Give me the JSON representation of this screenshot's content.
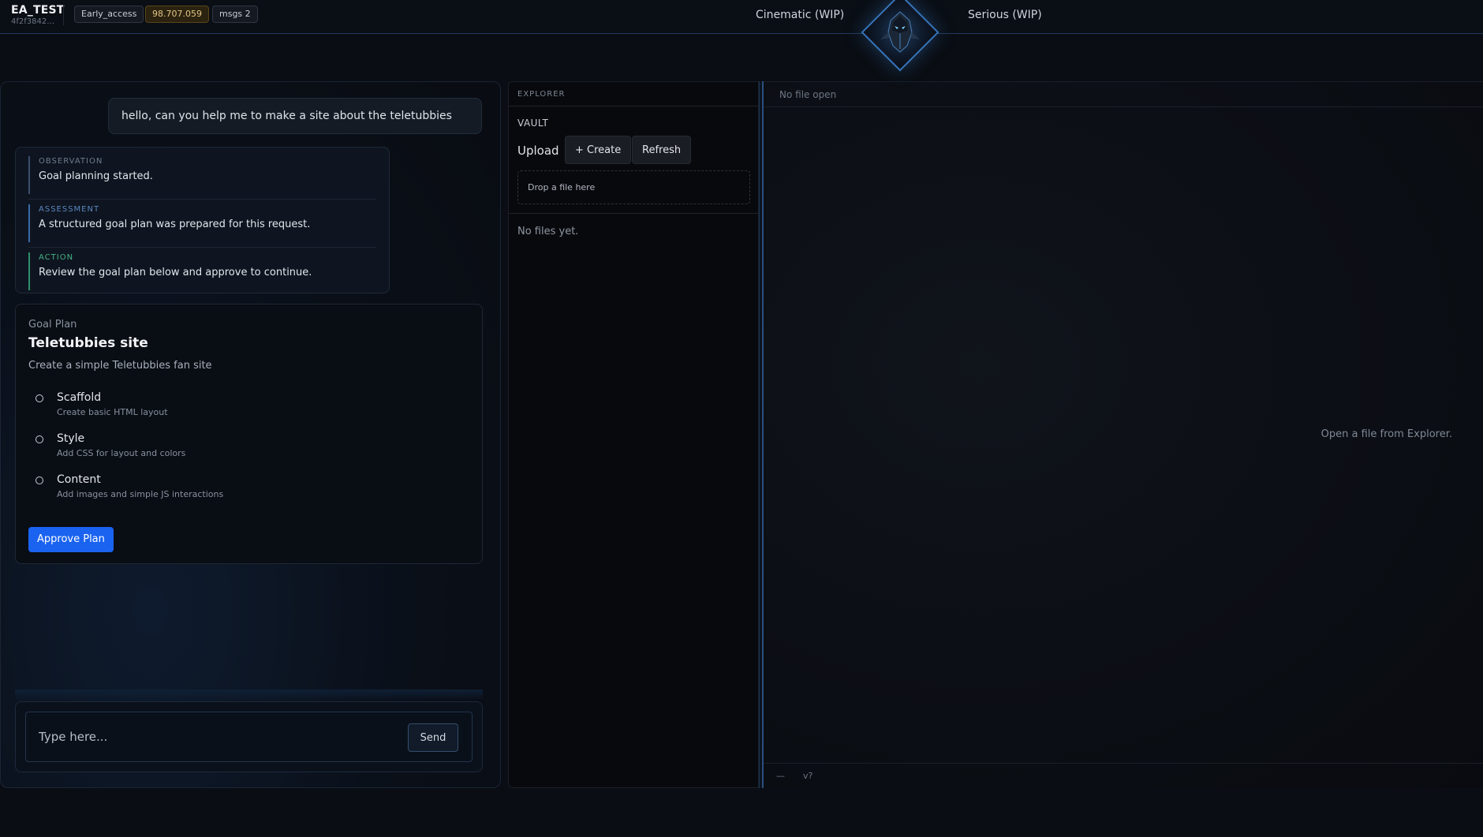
{
  "header": {
    "brand_title": "EA_TEST",
    "brand_sub": "4f2f3842…",
    "chips": {
      "tier": "Early_access",
      "balance": "98.707.059",
      "messages": "msgs 2"
    },
    "modes": {
      "left": "Cinematic (WIP)",
      "right": "Serious (WIP)"
    },
    "emblem_icon": "armored-knight-emblem-icon"
  },
  "chat": {
    "user_message": "hello, can you help me to make a site about the teletubbies",
    "analysis": [
      {
        "label": "OBSERVATION",
        "text": "Goal planning started."
      },
      {
        "label": "ASSESSMENT",
        "text": "A structured goal plan was prepared for this request."
      },
      {
        "label": "ACTION",
        "text": "Review the goal plan below and approve to continue."
      }
    ],
    "goal_plan": {
      "kicker": "Goal Plan",
      "title": "Teletubbies site",
      "description": "Create a simple Teletubbies fan site",
      "steps": [
        {
          "title": "Scaffold",
          "detail": "Create basic HTML layout"
        },
        {
          "title": "Style",
          "detail": "Add CSS for layout and colors"
        },
        {
          "title": "Content",
          "detail": "Add images and simple JS interactions"
        }
      ],
      "approve_label": "Approve Plan"
    },
    "composer": {
      "placeholder": "Type here...",
      "value": "",
      "send_label": "Send"
    }
  },
  "explorer": {
    "header": "EXPLORER",
    "vault_label": "VAULT",
    "upload_label": "Upload",
    "create_label": "+ Create",
    "refresh_label": "Refresh",
    "dropzone_text": "Drop a file here",
    "empty_text": "No files yet."
  },
  "editor": {
    "tab_text": "No file open",
    "empty_text": "Open a file from Explorer.",
    "status_left": "—",
    "status_version": "v?"
  },
  "colors": {
    "accent": "#1a63f0",
    "frame_blue": "#3673b8",
    "gold_chip": "#e3c684",
    "action_green": "#46b184"
  }
}
